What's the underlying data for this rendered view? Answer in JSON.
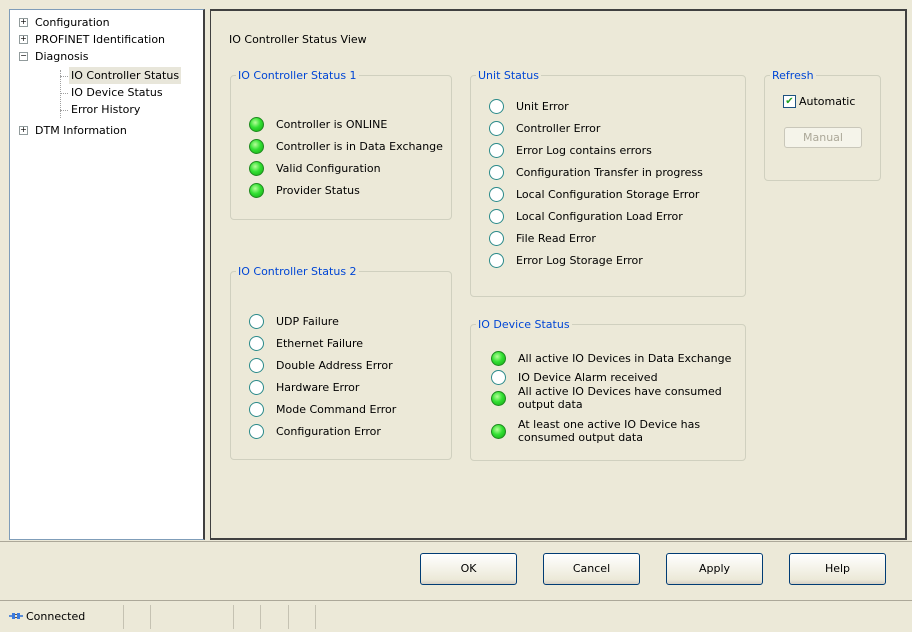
{
  "tree": {
    "items": [
      {
        "label": "Configuration",
        "expander": "+"
      },
      {
        "label": "PROFINET Identification",
        "expander": "+"
      },
      {
        "label": "Diagnosis",
        "expander": "−"
      },
      {
        "label": "IO Controller Status"
      },
      {
        "label": "IO Device Status"
      },
      {
        "label": "Error History"
      },
      {
        "label": "DTM Information",
        "expander": "+"
      }
    ],
    "selected_index": 3
  },
  "main": {
    "title": "IO Controller Status View",
    "controller_status_1": {
      "legend": "IO Controller Status 1",
      "items": [
        {
          "label": "Controller is ONLINE",
          "on": true
        },
        {
          "label": "Controller is in Data Exchange",
          "on": true
        },
        {
          "label": "Valid Configuration",
          "on": true
        },
        {
          "label": "Provider Status",
          "on": true
        }
      ]
    },
    "controller_status_2": {
      "legend": "IO Controller Status 2",
      "items": [
        {
          "label": "UDP Failure",
          "on": false
        },
        {
          "label": "Ethernet Failure",
          "on": false
        },
        {
          "label": "Double Address Error",
          "on": false
        },
        {
          "label": "Hardware Error",
          "on": false
        },
        {
          "label": "Mode Command Error",
          "on": false
        },
        {
          "label": "Configuration Error",
          "on": false
        }
      ]
    },
    "unit_status": {
      "legend": "Unit Status",
      "items": [
        {
          "label": "Unit Error",
          "on": false
        },
        {
          "label": "Controller Error",
          "on": false
        },
        {
          "label": "Error Log contains errors",
          "on": false
        },
        {
          "label": "Configuration Transfer in progress",
          "on": false
        },
        {
          "label": "Local Configuration Storage Error",
          "on": false
        },
        {
          "label": "Local Configuration Load Error",
          "on": false
        },
        {
          "label": "File Read Error",
          "on": false
        },
        {
          "label": "Error Log Storage Error",
          "on": false
        }
      ]
    },
    "device_status": {
      "legend": "IO Device Status",
      "items": [
        {
          "line1": "All active IO Devices in Data Exchange",
          "line2": "",
          "on": true
        },
        {
          "line1": "IO Device Alarm received",
          "line2": "",
          "on": false
        },
        {
          "line1": "All active IO Devices have consumed",
          "line2": "output data",
          "on": true
        },
        {
          "line1": "At least one active IO Device has",
          "line2": "consumed output data",
          "on": true
        }
      ]
    },
    "refresh": {
      "legend": "Refresh",
      "automatic_label": "Automatic",
      "automatic_checked": true,
      "manual_label": "Manual"
    }
  },
  "buttons": {
    "ok": "OK",
    "cancel": "Cancel",
    "apply": "Apply",
    "help": "Help"
  },
  "statusbar": {
    "connection": "Connected"
  },
  "colors": {
    "legend": "#0046d5",
    "led_on": "#33e033",
    "window_bg": "#ece9d8"
  }
}
